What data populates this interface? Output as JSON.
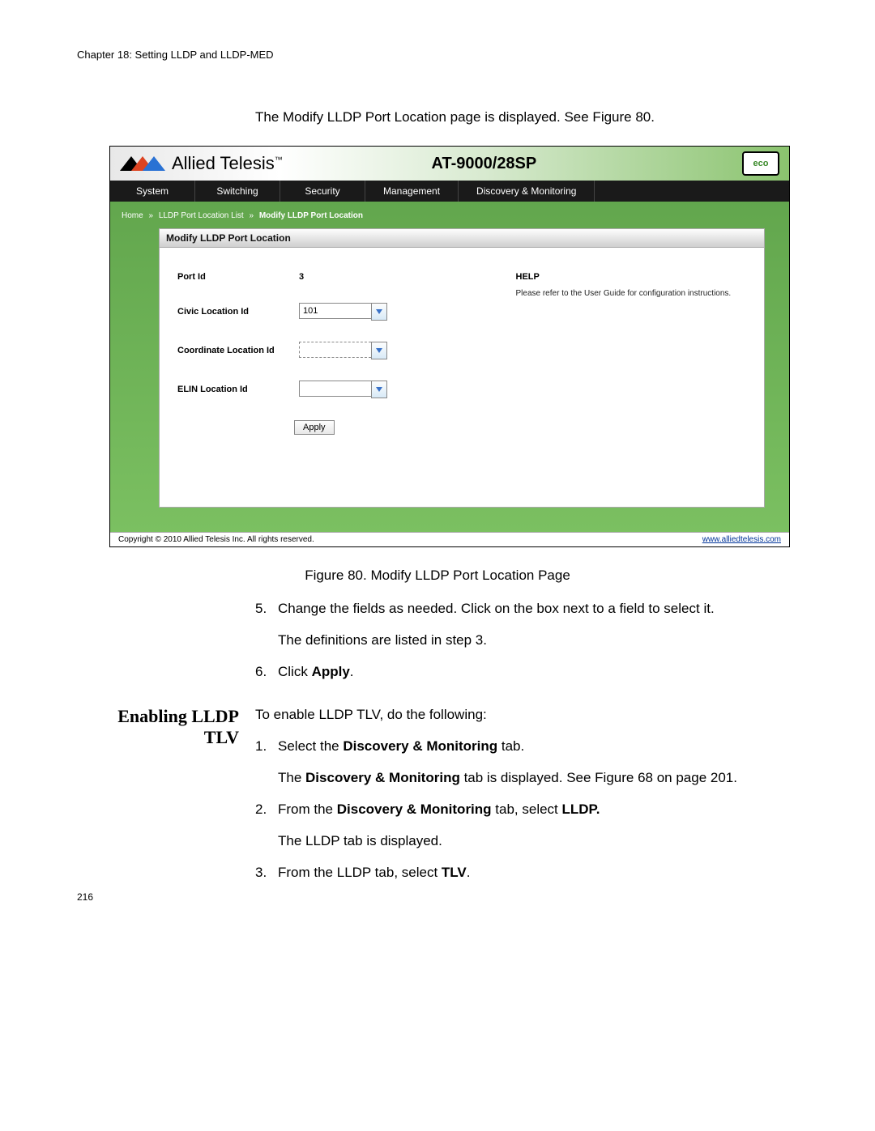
{
  "doc": {
    "chapter_header": "Chapter 18: Setting LLDP and LLDP-MED",
    "intro": "The Modify LLDP Port Location page is displayed. See Figure 80.",
    "caption": "Figure 80. Modify LLDP Port Location Page",
    "step5": "Change the fields as needed. Click on the box next to a field to select it.",
    "step5b": "The definitions are listed in step 3.",
    "step6_pre": "Click ",
    "step6_bold": "Apply",
    "step6_post": ".",
    "section_heading_l1": "Enabling LLDP",
    "section_heading_l2": "TLV",
    "sec_intro": "To enable LLDP TLV, do the following:",
    "s1_pre": "Select the ",
    "s1_bold": "Discovery & Monitoring",
    "s1_post": " tab.",
    "s1b_pre": "The ",
    "s1b_bold": "Discovery & Monitoring",
    "s1b_post": " tab is displayed. See Figure 68 on page 201.",
    "s2_pre": "From the ",
    "s2_bold1": "Discovery & Monitoring",
    "s2_mid": " tab, select ",
    "s2_bold2": "LLDP.",
    "s2b": "The LLDP tab is displayed.",
    "s3_pre": "From the LLDP tab, select ",
    "s3_bold": "TLV",
    "s3_post": ".",
    "page_number": "216"
  },
  "ui": {
    "brand": "Allied Telesis",
    "model": "AT-9000/28SP",
    "eco": "eco",
    "nav": [
      "System",
      "Switching",
      "Security",
      "Management",
      "Discovery & Monitoring"
    ],
    "breadcrumb": {
      "home": "Home",
      "l1": "LLDP Port Location List",
      "l2": "Modify LLDP Port Location"
    },
    "panel_title": "Modify LLDP Port Location",
    "fields": {
      "port_label": "Port Id",
      "port_value": "3",
      "civic_label": "Civic Location Id",
      "civic_value": "101",
      "coord_label": "Coordinate Location Id",
      "coord_value": "",
      "elin_label": "ELIN Location Id",
      "elin_value": ""
    },
    "apply": "Apply",
    "help_title": "HELP",
    "help_text": "Please refer to the User Guide for configuration instructions.",
    "copyright": "Copyright © 2010 Allied Telesis Inc. All rights reserved.",
    "site_link": "www.alliedtelesis.com"
  }
}
